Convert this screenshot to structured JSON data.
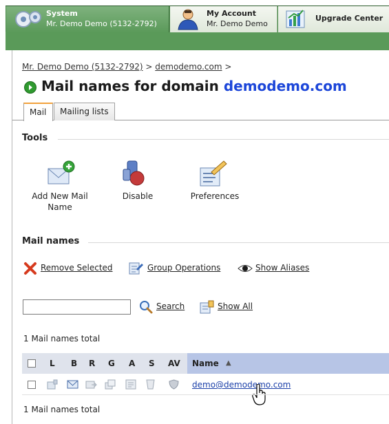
{
  "topnav": {
    "system": {
      "title": "System",
      "subtitle": "Mr. Demo Demo (5132-2792)"
    },
    "account": {
      "title": "My Account",
      "subtitle": "Mr. Demo Demo"
    },
    "upgrade": {
      "title": "Upgrade Center"
    }
  },
  "breadcrumb": {
    "items": [
      "Mr. Demo Demo (5132-2792)",
      "demodemo.com"
    ],
    "separator": ">"
  },
  "page": {
    "title_prefix": "Mail names for domain",
    "domain": "demodemo.com"
  },
  "tabs": [
    {
      "label": "Mail",
      "active": true
    },
    {
      "label": "Mailing lists",
      "active": false
    }
  ],
  "tools": {
    "heading": "Tools",
    "items": [
      {
        "label": "Add New Mail Name",
        "icon": "add-mail-icon"
      },
      {
        "label": "Disable",
        "icon": "disable-icon"
      },
      {
        "label": "Preferences",
        "icon": "preferences-icon"
      }
    ]
  },
  "mailnames": {
    "heading": "Mail names",
    "actions": {
      "remove_selected": "Remove Selected",
      "group_operations": "Group Operations",
      "show_aliases": "Show Aliases"
    },
    "search": {
      "value": "",
      "button": "Search",
      "show_all": "Show All"
    },
    "total_top": "1 Mail names total",
    "total_bottom": "1 Mail names total",
    "columns": [
      "L",
      "B",
      "R",
      "G",
      "A",
      "S",
      "AV",
      "Name"
    ],
    "sort_indicator": "▲",
    "rows": [
      {
        "name": "demo@demodemo.com"
      }
    ]
  },
  "colors": {
    "nav_green": "#4f8d4e",
    "link_blue": "#1c46d9",
    "header_blue": "#b7c5e6",
    "tab_accent": "#f2a23c"
  }
}
